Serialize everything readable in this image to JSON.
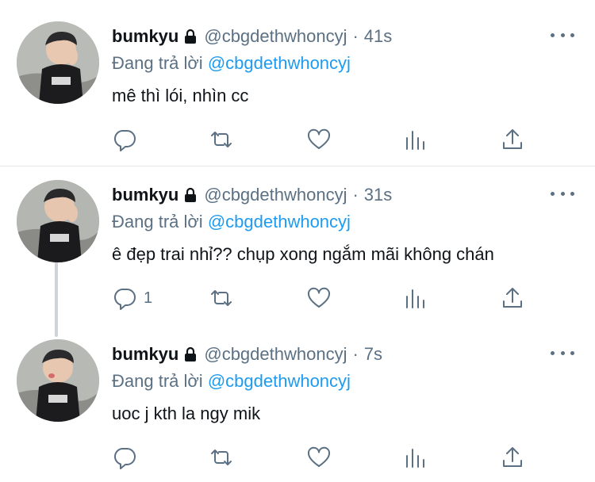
{
  "tweets": [
    {
      "name": "bumkyu",
      "handle": "@cbgdethwhoncyj",
      "separator": "·",
      "time": "41s",
      "reply_prefix": "Đang trả lời",
      "reply_to": "@cbgdethwhoncyj",
      "text": "mê thì lói, nhìn cc",
      "reply_count": ""
    },
    {
      "name": "bumkyu",
      "handle": "@cbgdethwhoncyj",
      "separator": "·",
      "time": "31s",
      "reply_prefix": "Đang trả lời",
      "reply_to": "@cbgdethwhoncyj",
      "text": "ê đẹp trai nhỉ?? chụp xong ngắm mãi không chán",
      "reply_count": "1"
    },
    {
      "name": "bumkyu",
      "handle": "@cbgdethwhoncyj",
      "separator": "·",
      "time": "7s",
      "reply_prefix": "Đang trả lời",
      "reply_to": "@cbgdethwhoncyj",
      "text": "uoc j kth la ngy mik",
      "reply_count": ""
    }
  ],
  "icons": {
    "lock": "lock-icon",
    "more": "more-icon",
    "reply": "reply-icon",
    "retweet": "retweet-icon",
    "like": "heart-icon",
    "stats": "stats-icon",
    "share": "share-icon"
  },
  "colors": {
    "text": "#0f1419",
    "secondary": "#5b7083",
    "accent": "#1d9bf0",
    "divider": "#e6e9eb",
    "thread_line": "#d0d4d8"
  }
}
